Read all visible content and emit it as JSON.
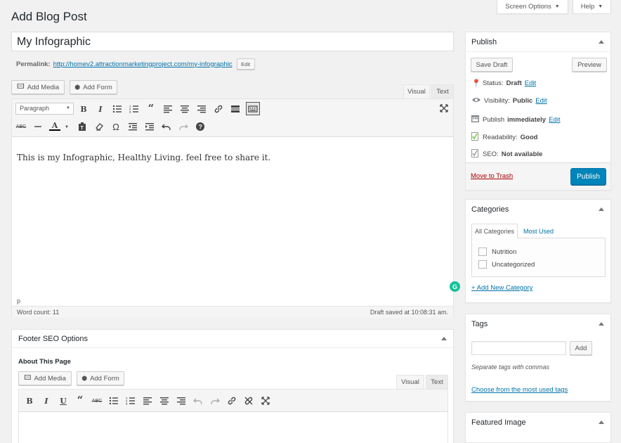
{
  "page": {
    "title": "Add Blog Post"
  },
  "topbar": {
    "screen_options": "Screen Options",
    "help": "Help"
  },
  "post": {
    "title_value": "My Infographic",
    "permalink_label": "Permalink:",
    "permalink_url": "http://homev2.attractionmarketingproject.com/my-infographic",
    "permalink_edit": "Edit"
  },
  "editor": {
    "add_media": "Add Media",
    "add_form": "Add Form",
    "tab_visual": "Visual",
    "tab_text": "Text",
    "format_select": "Paragraph",
    "content": "This is my Infographic, Healthy Living. feel free to share it.",
    "path": "p",
    "word_count": "Word count: 11",
    "draft_saved": "Draft saved at 10:08:31 am."
  },
  "footer_seo": {
    "title": "Footer SEO Options",
    "about_label": "About This Page",
    "add_media": "Add Media",
    "add_form": "Add Form",
    "tab_visual": "Visual",
    "tab_text": "Text"
  },
  "publish": {
    "title": "Publish",
    "save_draft": "Save Draft",
    "preview": "Preview",
    "status_label": "Status:",
    "status_value": "Draft",
    "status_edit": "Edit",
    "visibility_label": "Visibility:",
    "visibility_value": "Public",
    "visibility_edit": "Edit",
    "schedule_label": "Publish",
    "schedule_value": "immediately",
    "schedule_edit": "Edit",
    "readability_label": "Readability:",
    "readability_value": "Good",
    "seo_label": "SEO:",
    "seo_value": "Not available",
    "trash": "Move to Trash",
    "publish_btn": "Publish"
  },
  "categories": {
    "title": "Categories",
    "tab_all": "All Categories",
    "tab_used": "Most Used",
    "items": [
      "Nutrition",
      "Uncategorized"
    ],
    "add_new": "+ Add New Category"
  },
  "tags": {
    "title": "Tags",
    "add": "Add",
    "hint": "Separate tags with commas",
    "choose": "Choose from the most used tags"
  },
  "featured": {
    "title": "Featured Image"
  },
  "colors": {
    "primary": "#0085ba",
    "link": "#0073aa",
    "trash": "#a00"
  }
}
